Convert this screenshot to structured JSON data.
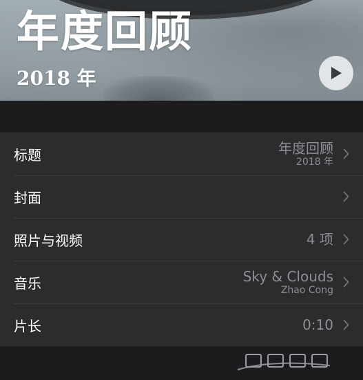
{
  "hero": {
    "title": "年度回顾",
    "year": "2018 年"
  },
  "settings": {
    "rows": [
      {
        "label": "标题",
        "value": "年度回顾",
        "subvalue": "2018 年"
      },
      {
        "label": "封面",
        "value": "",
        "subvalue": ""
      },
      {
        "label": "照片与视频",
        "value": "4 项",
        "subvalue": ""
      },
      {
        "label": "音乐",
        "value": "Sky & Clouds",
        "subvalue": "Zhao Cong"
      },
      {
        "label": "片长",
        "value": "0:10",
        "subvalue": ""
      }
    ]
  },
  "colors": {
    "background": "#1c1c1e",
    "row_background": "#2c2c2e",
    "secondary_text": "#8e8e93"
  },
  "icons": {
    "play": "play-icon",
    "chevron": "chevron-right-icon"
  }
}
